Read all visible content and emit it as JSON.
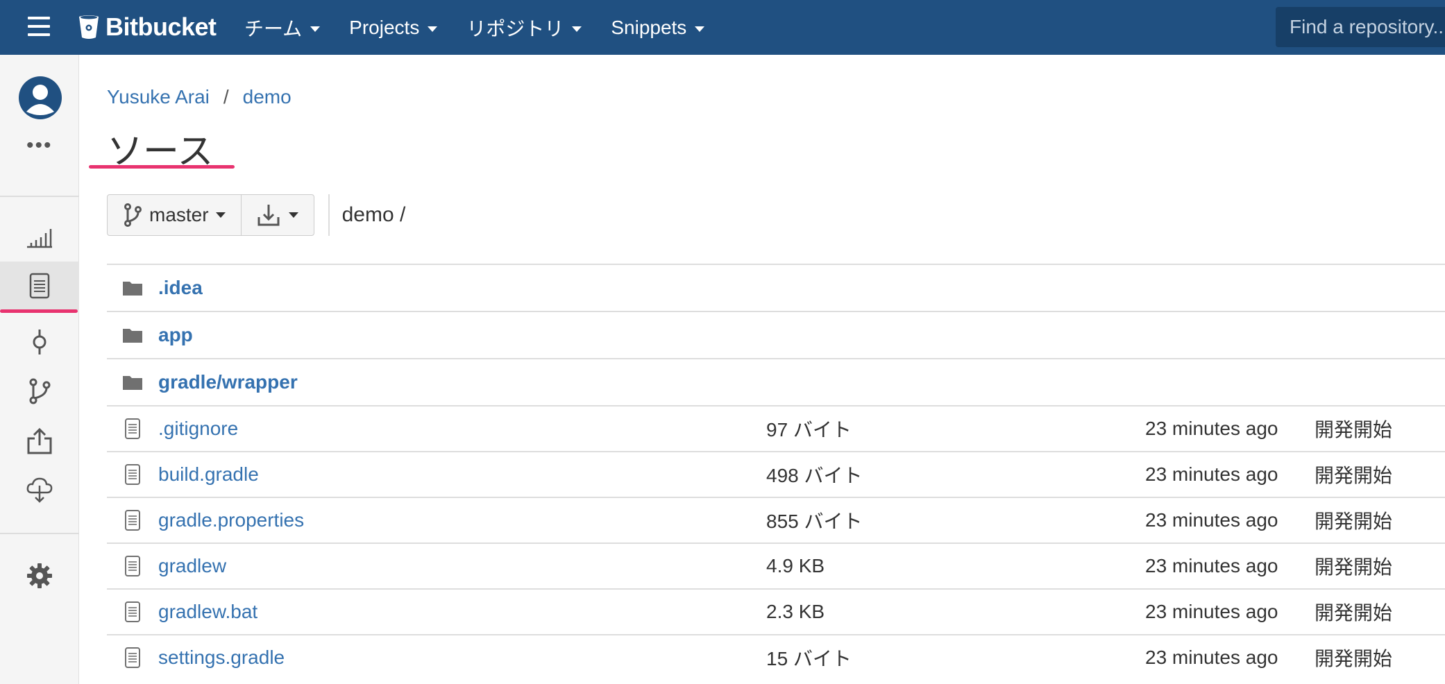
{
  "topnav": {
    "logo_text": "Bitbucket",
    "items": [
      {
        "label": "チーム"
      },
      {
        "label": "Projects"
      },
      {
        "label": "リポジトリ"
      },
      {
        "label": "Snippets"
      }
    ],
    "search_placeholder": "Find a repository...",
    "background_color": "#205081"
  },
  "sidebar": {
    "icons": [
      "avatar-icon",
      "more-icon",
      "overview-icon",
      "source-icon",
      "commits-icon",
      "branches-icon",
      "pull-requests-icon",
      "downloads-icon",
      "settings-icon"
    ],
    "active_item": "source-icon",
    "more_label": "•••"
  },
  "breadcrumb": {
    "owner": "Yusuke Arai",
    "separator": "/",
    "repo": "demo"
  },
  "page": {
    "title": "ソース",
    "accent_color": "#e8336f"
  },
  "toolbar": {
    "branch_label": "master",
    "path": "demo /"
  },
  "files": [
    {
      "type": "dir",
      "name": ".idea",
      "size": "",
      "time": "",
      "message": ""
    },
    {
      "type": "dir",
      "name": "app",
      "size": "",
      "time": "",
      "message": ""
    },
    {
      "type": "dir",
      "name": "gradle/wrapper",
      "size": "",
      "time": "",
      "message": ""
    },
    {
      "type": "file",
      "name": ".gitignore",
      "size": "97 バイト",
      "time": "23 minutes ago",
      "message": "開発開始"
    },
    {
      "type": "file",
      "name": "build.gradle",
      "size": "498 バイト",
      "time": "23 minutes ago",
      "message": "開発開始"
    },
    {
      "type": "file",
      "name": "gradle.properties",
      "size": "855 バイト",
      "time": "23 minutes ago",
      "message": "開発開始"
    },
    {
      "type": "file",
      "name": "gradlew",
      "size": "4.9 KB",
      "time": "23 minutes ago",
      "message": "開発開始"
    },
    {
      "type": "file",
      "name": "gradlew.bat",
      "size": "2.3 KB",
      "time": "23 minutes ago",
      "message": "開発開始"
    },
    {
      "type": "file",
      "name": "settings.gradle",
      "size": "15 バイト",
      "time": "23 minutes ago",
      "message": "開発開始"
    }
  ]
}
